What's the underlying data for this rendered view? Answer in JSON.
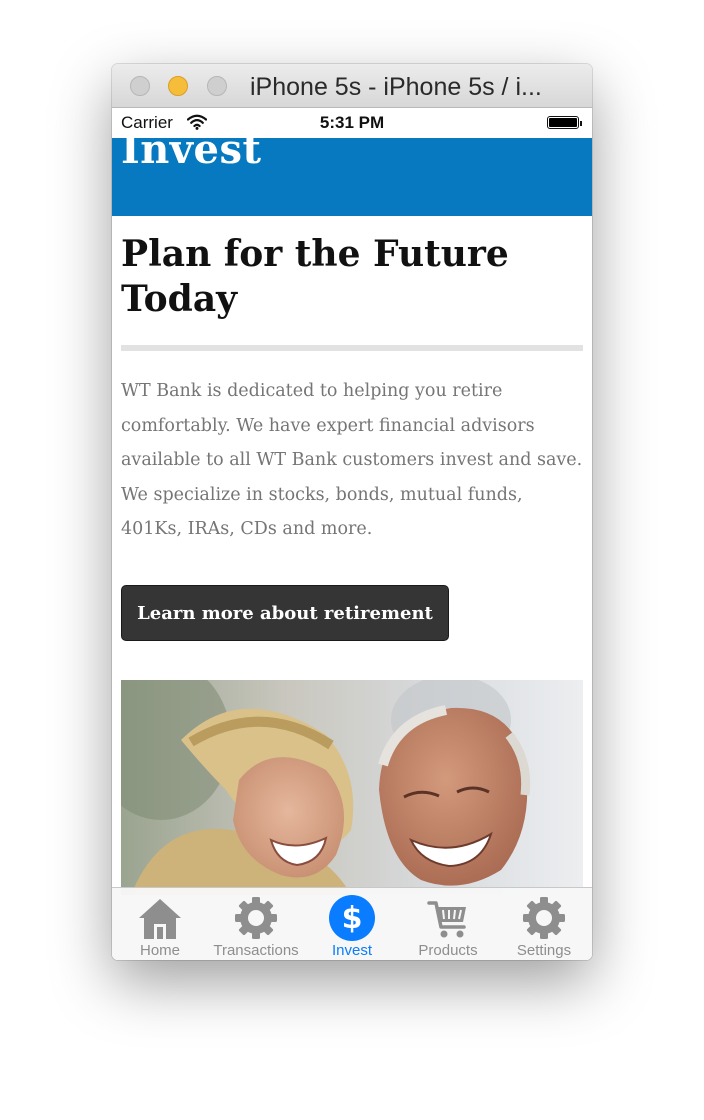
{
  "window": {
    "title": "iPhone 5s - iPhone 5s / i..."
  },
  "status_bar": {
    "carrier": "Carrier",
    "time": "5:31 PM"
  },
  "header": {
    "title": "Invest",
    "color": "#0679c1"
  },
  "main": {
    "heading": "Plan for the Future Today",
    "body": "WT Bank is dedicated to helping you retire comfortably. We have expert financial advisors available to all WT Bank customers invest and save. We specialize in stocks, bonds, mutual funds, 401Ks, IRAs, CDs and more.",
    "cta_label": "Learn more about retirement",
    "image_icon": "retired-couple-photo"
  },
  "tab_bar": {
    "active_color": "#0a7cff",
    "inactive_color": "#8e8e8e",
    "items": [
      {
        "label": "Home",
        "icon": "home-icon",
        "active": false
      },
      {
        "label": "Transactions",
        "icon": "gear-icon",
        "active": false
      },
      {
        "label": "Invest",
        "icon": "dollar-icon",
        "active": true
      },
      {
        "label": "Products",
        "icon": "cart-icon",
        "active": false
      },
      {
        "label": "Settings",
        "icon": "gear-icon",
        "active": false
      }
    ]
  }
}
